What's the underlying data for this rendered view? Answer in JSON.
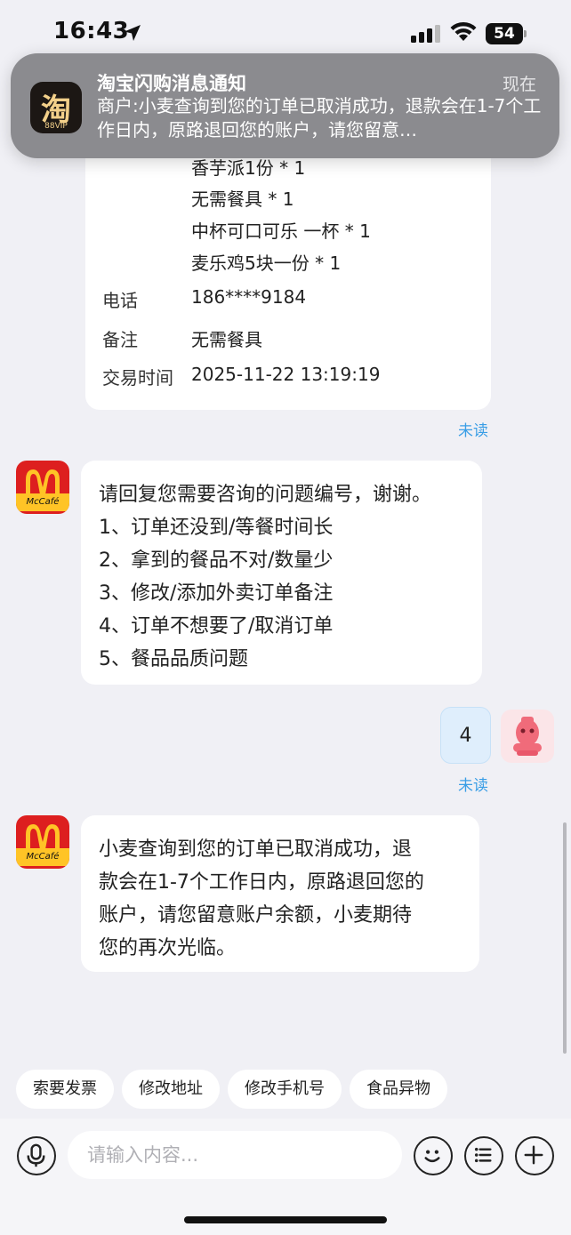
{
  "status_bar": {
    "time": "16:43",
    "battery": "54"
  },
  "notification": {
    "app_icon_char": "淘",
    "app_icon_badge": "88VIP",
    "title": "淘宝闪购消息通知",
    "time": "现在",
    "body": "商户:小麦查询到您的订单已取消成功，退款会在1-7个工作日内，原路退回您的账户，请您留意…"
  },
  "order_card": {
    "items": [
      "香芋派1份 * 1",
      "无需餐具 * 1",
      "中杯可口可乐 一杯 * 1",
      "麦乐鸡5块一份 * 1"
    ],
    "phone_label": "电话",
    "phone_value": "186****9184",
    "remark_label": "备注",
    "remark_value": "无需餐具",
    "time_label": "交易时间",
    "time_value": "2025-11-22 13:19:19"
  },
  "unread_label": "未读",
  "messages": {
    "menu": {
      "avatar_brand": "McCafé",
      "lines": [
        "请回复您需要咨询的问题编号，谢谢。",
        "1、订单还没到/等餐时间长",
        "2、拿到的餐品不对/数量少",
        "3、修改/添加外卖订单备注",
        "4、订单不想要了/取消订单",
        "5、餐品品质问题"
      ]
    },
    "user_reply": "4",
    "result": {
      "avatar_brand": "McCafé",
      "lines": [
        "小麦查询到您的订单已取消成功，退",
        "款会在1-7个工作日内，原路退回您的",
        "账户，请您留意账户余额，小麦期待",
        "您的再次光临。"
      ]
    }
  },
  "quick_replies": [
    "索要发票",
    "修改地址",
    "修改手机号",
    "食品异物"
  ],
  "input": {
    "placeholder": "请输入内容..."
  },
  "icons": [
    "location-arrow-icon",
    "signal-icon",
    "wifi-icon",
    "microphone-icon",
    "emoji-icon",
    "menu-list-icon",
    "plus-icon"
  ]
}
